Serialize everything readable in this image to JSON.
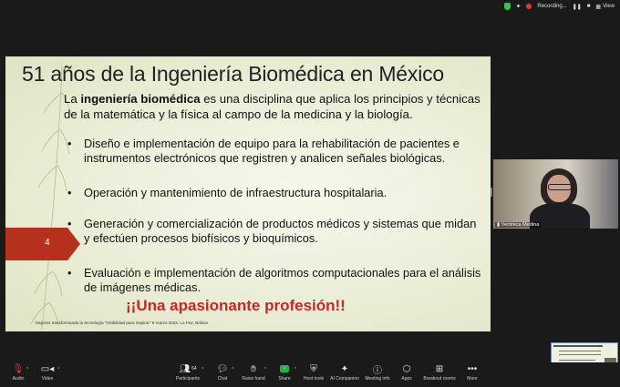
{
  "topbar": {
    "recording_label": "Recording...",
    "view_label": "View"
  },
  "slide": {
    "title": "51 años de la Ingeniería Biomédica en México",
    "intro_bold": "ingeniería biomédica",
    "intro_pre": "La ",
    "intro_post": " es una disciplina que aplica los principios y técnicas de la matemática y la física al campo de la medicina y la biología.",
    "bullets": [
      "Diseño e implementación de equipo para la rehabilitación de pacientes e instrumentos electrónicos que registren y analicen señales biológicas.",
      "Operación y mantenimiento de infraestructura hospitalaria.",
      "Generación y comercialización de productos médicos y sistemas que midan y efectúen procesos biofísicos y bioquímicos.",
      "Evaluación e implementación de algoritmos computacionales para el análisis de imágenes médicas."
    ],
    "bullet_marker": "•",
    "slogan": "¡¡Una apasionante profesión!!",
    "footer": "Mujeres transformando la tecnología \"Visibilidad para inspirar\" 8 marzo 2026. La Paz, Bolivia",
    "page_number": "4",
    "accent_color": "#b5311e",
    "slogan_color": "#c62828"
  },
  "participant": {
    "name": "Verónica Medina"
  },
  "toolbar": {
    "items": [
      {
        "label": "Audio",
        "icon": "microphone-muted-icon"
      },
      {
        "label": "Video",
        "icon": "video-camera-icon"
      },
      {
        "label": "Participants",
        "icon": "participants-icon",
        "count": "64"
      },
      {
        "label": "Chat",
        "icon": "chat-icon"
      },
      {
        "label": "Raise hand",
        "icon": "raise-hand-icon"
      },
      {
        "label": "Share",
        "icon": "share-screen-icon"
      },
      {
        "label": "Host tools",
        "icon": "shield-icon"
      },
      {
        "label": "AI Companion",
        "icon": "ai-sparkle-icon"
      },
      {
        "label": "Meeting info",
        "icon": "info-icon"
      },
      {
        "label": "Apps",
        "icon": "apps-icon"
      },
      {
        "label": "Breakout rooms",
        "icon": "breakout-rooms-icon"
      },
      {
        "label": "More",
        "icon": "more-icon"
      }
    ]
  }
}
